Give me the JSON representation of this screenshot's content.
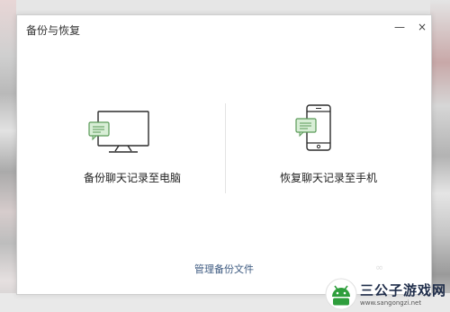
{
  "window": {
    "title": "备份与恢复",
    "minimize_glyph": "—",
    "close_glyph": "×"
  },
  "options": [
    {
      "label": "备份聊天记录至电脑",
      "icon": "monitor-chat-icon"
    },
    {
      "label": "恢复聊天记录至手机",
      "icon": "phone-chat-icon"
    }
  ],
  "footer": {
    "manage_link": "管理备份文件",
    "faint_mark": "∞"
  },
  "watermark": {
    "name": "三公子游戏网",
    "url": "www.sangongzi.net"
  },
  "colors": {
    "link": "#3d5a80",
    "chat_bubble": "#d8eed6",
    "chat_bubble_border": "#5a9a58",
    "icon_stroke": "#2b2b2b"
  }
}
